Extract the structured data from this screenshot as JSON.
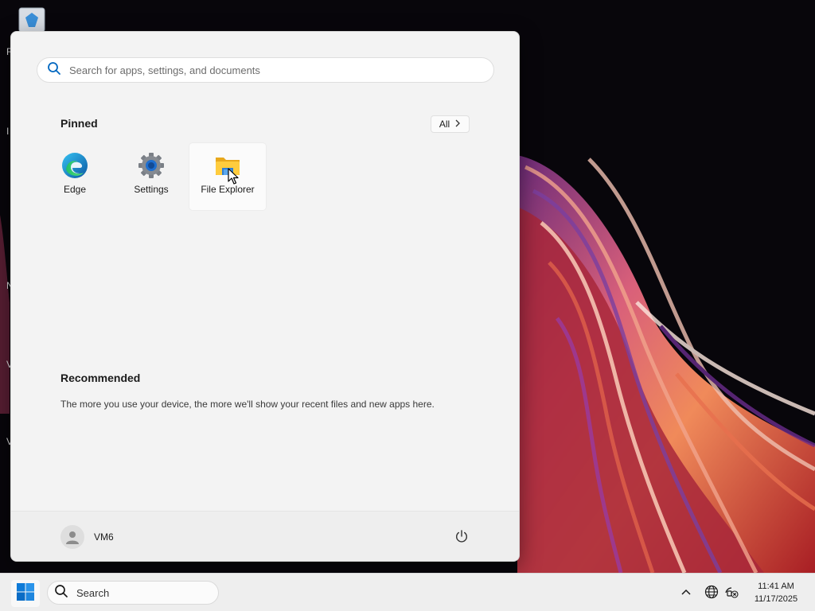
{
  "colors": {
    "accent": "#0067c0",
    "menu_bg": "#f3f3f3",
    "taskbar_bg": "#eeeeee"
  },
  "desktop": {
    "icons": [
      "recycle-bin-icon"
    ],
    "edge_letters": [
      "R",
      "I",
      "N",
      "V",
      "V"
    ]
  },
  "start_menu": {
    "search": {
      "placeholder": "Search for apps, settings, and documents",
      "value": ""
    },
    "pinned": {
      "title": "Pinned",
      "all_button": "All",
      "apps": [
        {
          "label": "Edge",
          "icon": "edge-icon"
        },
        {
          "label": "Settings",
          "icon": "gear-icon"
        },
        {
          "label": "File Explorer",
          "icon": "folder-icon",
          "hovered": true
        }
      ]
    },
    "recommended": {
      "title": "Recommended",
      "message": "The more you use your device, the more we'll show your recent files and new apps here."
    },
    "footer": {
      "user_name": "VM6",
      "power_icon": "power-icon"
    }
  },
  "taskbar": {
    "start_icon": "windows-logo-icon",
    "search_label": "Search",
    "tray": [
      "chevron-up-icon",
      "globe-icon",
      "network-icon"
    ],
    "clock": {
      "time": "11:41 AM",
      "date": "11/17/2025"
    }
  }
}
